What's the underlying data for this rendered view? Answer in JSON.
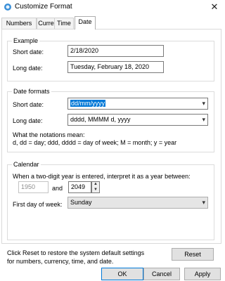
{
  "window": {
    "title": "Customize Format"
  },
  "tabs": [
    {
      "label": "Numbers"
    },
    {
      "label": "Currency"
    },
    {
      "label": "Time"
    },
    {
      "label": "Date"
    }
  ],
  "example": {
    "heading": "Example",
    "short_label": "Short date:",
    "short_value": "2/18/2020",
    "long_label": "Long date:",
    "long_value": "Tuesday, February 18, 2020"
  },
  "formats": {
    "heading": "Date formats",
    "short_label": "Short date:",
    "short_value": "dd/mm/yyyy",
    "long_label": "Long date:",
    "long_value": "dddd, MMMM d, yyyy",
    "notation_heading": "What the notations mean:",
    "notation_text": "d, dd = day;  ddd, dddd = day of week;  M = month;  y = year"
  },
  "calendar": {
    "heading": "Calendar",
    "two_digit_text": "When a two-digit year is entered, interpret it as a year between:",
    "year_from": "1950",
    "and_label": "and",
    "year_to": "2049",
    "first_day_label": "First day of week:",
    "first_day_value": "Sunday"
  },
  "footer": {
    "reset_text": "Click Reset to restore the system default settings for numbers, currency, time, and date.",
    "reset_button": "Reset",
    "ok_button": "OK",
    "cancel_button": "Cancel",
    "apply_button": "Apply"
  },
  "colors": {
    "selection": "#0078d7",
    "default_button_border": "#0078d7"
  }
}
